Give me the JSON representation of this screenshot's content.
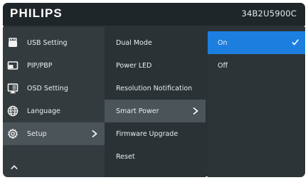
{
  "header": {
    "brand": "PHILIPS",
    "model": "34B2U5900C"
  },
  "menu": {
    "items": [
      {
        "label": "USB Setting",
        "icon": "usb-icon"
      },
      {
        "label": "PIP/PBP",
        "icon": "pip-pbp-icon"
      },
      {
        "label": "OSD Setting",
        "icon": "osd-setting-icon"
      },
      {
        "label": "Language",
        "icon": "globe-icon"
      },
      {
        "label": "Setup",
        "icon": "gear-icon",
        "selected": true
      }
    ],
    "scroll_up_icon": "chevron-up-icon"
  },
  "submenu": {
    "items": [
      {
        "label": "Dual Mode"
      },
      {
        "label": "Power LED"
      },
      {
        "label": "Resolution Notification"
      },
      {
        "label": "Smart Power",
        "selected": true
      },
      {
        "label": "Firmware Upgrade"
      },
      {
        "label": "Reset"
      }
    ]
  },
  "options": {
    "items": [
      {
        "label": "On",
        "active": true
      },
      {
        "label": "Off"
      }
    ]
  },
  "colors": {
    "accent": "#1c7fe0",
    "header_bg": "#1f2629",
    "panel_bg": "#2b3236",
    "selected_bg": "#4b5459"
  }
}
